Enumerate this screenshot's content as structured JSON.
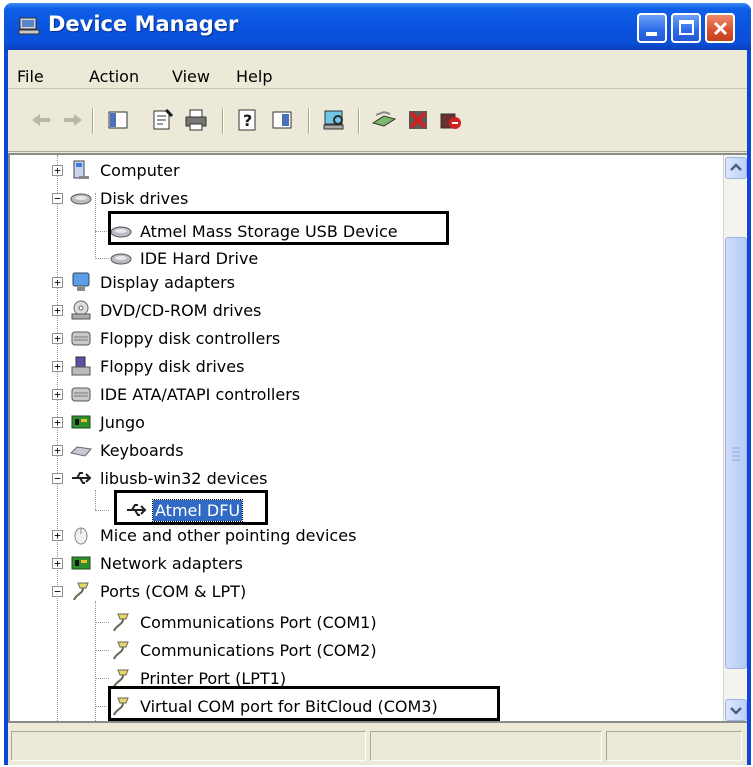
{
  "window": {
    "title": "Device Manager"
  },
  "menu": [
    "File",
    "Action",
    "View",
    "Help"
  ],
  "toolbar": [
    "back-icon",
    "forward-icon",
    "show-hide-console-tree-icon",
    "properties-icon",
    "print-icon",
    "help-icon",
    "view-icon",
    "scan-hardware-icon",
    "update-driver-icon",
    "disable-icon",
    "uninstall-icon"
  ],
  "tree": {
    "computer": "Computer",
    "disk_drives": "Disk drives",
    "disk_1": "Atmel Mass Storage USB Device",
    "disk_2": "IDE Hard Drive",
    "display": "Display adapters",
    "dvd": "DVD/CD-ROM drives",
    "floppy_ctrl": "Floppy disk controllers",
    "floppy": "Floppy disk drives",
    "ide": "IDE ATA/ATAPI controllers",
    "jungo": "Jungo",
    "keyboards": "Keyboards",
    "libusb": "libusb-win32 devices",
    "libusb_1": "Atmel DFU",
    "mice": "Mice and other pointing devices",
    "network": "Network adapters",
    "ports": "Ports (COM & LPT)",
    "port_1": "Communications Port (COM1)",
    "port_2": "Communications Port (COM2)",
    "port_3": "Printer Port (LPT1)",
    "port_4": "Virtual COM port for BitCloud (COM3)"
  },
  "colors": {
    "titlebar": "#0a54e0",
    "selection": "#316ac5",
    "chrome": "#ece9d8"
  }
}
